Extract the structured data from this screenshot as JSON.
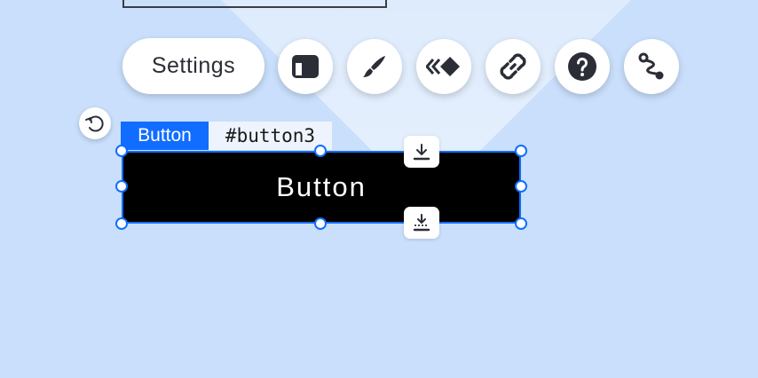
{
  "toolbar": {
    "settings_label": "Settings",
    "icons": [
      "layout-icon",
      "brush-icon",
      "animation-icon",
      "link-icon",
      "help-icon",
      "connect-icon"
    ]
  },
  "selection": {
    "type_label": "Button",
    "element_id": "#button3"
  },
  "canvas": {
    "button_text": "Button"
  },
  "colors": {
    "accent": "#116dff",
    "background": "#c9dffb",
    "icon": "#2b2e36"
  }
}
